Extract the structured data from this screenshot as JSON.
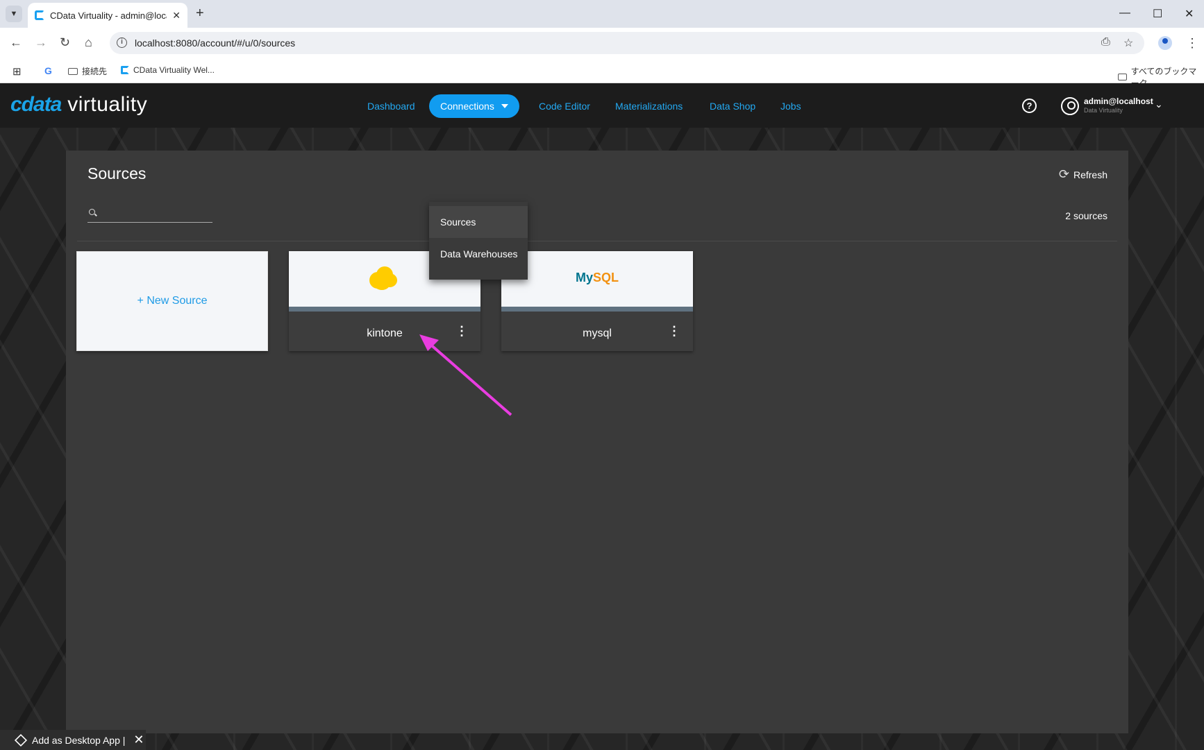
{
  "browser": {
    "tab_title": "CData Virtuality - admin@locall",
    "url": "localhost:8080/account/#/u/0/sources",
    "bookmarks": [
      "接続先",
      "CData Virtuality Wel..."
    ],
    "all_bookmarks": "すべてのブックマーク"
  },
  "app": {
    "logo_brand": "cdata",
    "logo_product": "virtuality",
    "nav": [
      "Dashboard",
      "Connections",
      "Code Editor",
      "Materializations",
      "Data Shop",
      "Jobs"
    ],
    "user": {
      "name": "admin@localhost",
      "subtitle": "Data Virtuality"
    },
    "dropdown": [
      "Sources",
      "Data Warehouses"
    ]
  },
  "page": {
    "title": "Sources",
    "refresh_label": "Refresh",
    "search_placeholder": "",
    "count_label": "2 sources",
    "new_source_label": "+ New Source",
    "sources": [
      {
        "name": "kintone",
        "logo": "kintone-cloud"
      },
      {
        "name": "mysql",
        "logo": "mysql-dolphin"
      }
    ],
    "mysql_logo_text": {
      "my": "My",
      "sql": "SQL"
    }
  },
  "footer": {
    "desktop_app_label": "Add as Desktop App |"
  },
  "colors": {
    "accent": "#119cf0",
    "nav_link": "#23a9f2",
    "annotation_arrow": "#e93de0"
  }
}
